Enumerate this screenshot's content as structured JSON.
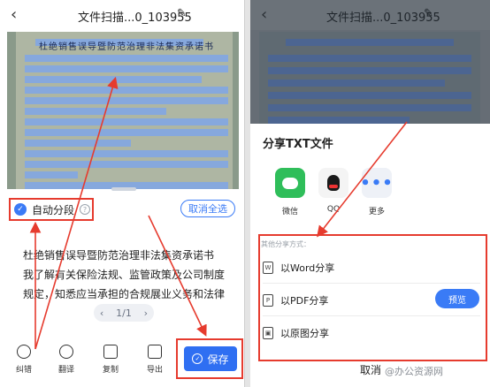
{
  "left": {
    "title": "文件扫描...0_103955",
    "document_heading": "杜绝销售误导暨防范治理非法集资承诺书",
    "auto_paragraph_label": "自动分段",
    "cancel_select_all": "取消全选",
    "text_lines": [
      "杜绝销售误导暨防范治理非法集资承诺书",
      "我了解有关保险法规、监管政策及公司制度",
      "规定，知悉应当承担的合规展业义务和法律"
    ],
    "page_indicator": "1/1",
    "toolbar": {
      "correct": "纠错",
      "translate": "翻译",
      "copy": "复制",
      "export": "导出",
      "save": "保存"
    }
  },
  "right": {
    "title": "文件扫描...0_103955",
    "sheet_title": "分享TXT文件",
    "apps": [
      {
        "name": "微信",
        "icon": "wechat-icon"
      },
      {
        "name": "QQ",
        "icon": "qq-icon"
      },
      {
        "name": "更多",
        "icon": "more-icon"
      }
    ],
    "other_share_label": "其他分享方式：",
    "options": [
      {
        "label": "以Word分享",
        "icon": "word-icon"
      },
      {
        "label": "以PDF分享",
        "icon": "pdf-icon"
      },
      {
        "label": "以原图分享",
        "icon": "image-icon"
      }
    ],
    "preview_button": "预览",
    "cancel": "取消",
    "watermark": "@办公资源网"
  },
  "colors": {
    "accent": "#2f6ff2",
    "highlight": "#e63b2e",
    "wechat": "#2fbe5a"
  }
}
